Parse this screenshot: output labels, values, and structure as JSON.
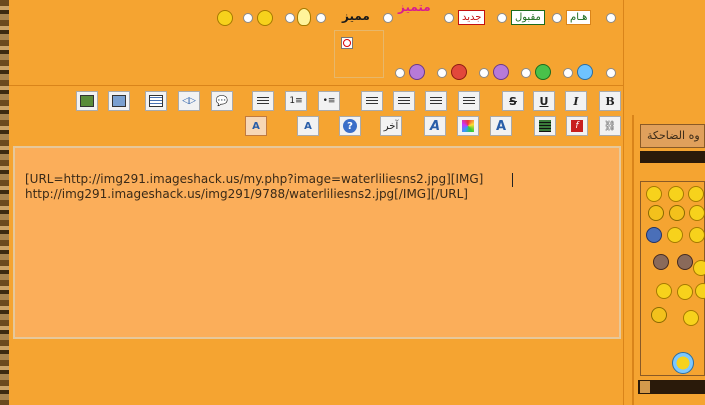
{
  "post_icons_row1": {
    "tags": [
      {
        "label": "هـام",
        "color": "#1c6b1c",
        "bg": "#ffffff"
      },
      {
        "label": "مقبول",
        "color": "#1c6b1c",
        "bg": "#ffffff"
      },
      {
        "label": "جديد",
        "color": "#c31010",
        "bg": "#ffffff"
      }
    ],
    "featured_text": "متميز",
    "distinguished_text": "مميز"
  },
  "colors": {
    "background": "#f5a431",
    "editor_bg": "#fbae5a",
    "editor_border": "#e6c89b",
    "accent": "#d9841a"
  },
  "toolbar": {
    "row1_buttons": [
      "image-icon",
      "gallery-icon",
      "table-icon",
      "media-icon",
      "quote-icon",
      "align-justify-icon",
      "ordered-list-icon",
      "unordered-list-icon",
      "align-left-icon",
      "align-right-icon",
      "align-center-icon",
      "align-full-icon",
      "strikethrough",
      "underline",
      "italic",
      "bold"
    ],
    "row2_labels": {
      "strike": "S",
      "underline": "U",
      "italic": "I",
      "bold": "B",
      "font_text": "آخر",
      "help": "?"
    }
  },
  "editor": {
    "line1": "[URL=http://img291.imageshack.us/my.php?image=waterliliesns2.jpg][IMG]",
    "line2": "http://img291.imageshack.us/img291/9788/waterliliesns2.jpg[/IMG][/URL]"
  },
  "smilies_panel": {
    "category_label": "وه الضاحكة"
  }
}
